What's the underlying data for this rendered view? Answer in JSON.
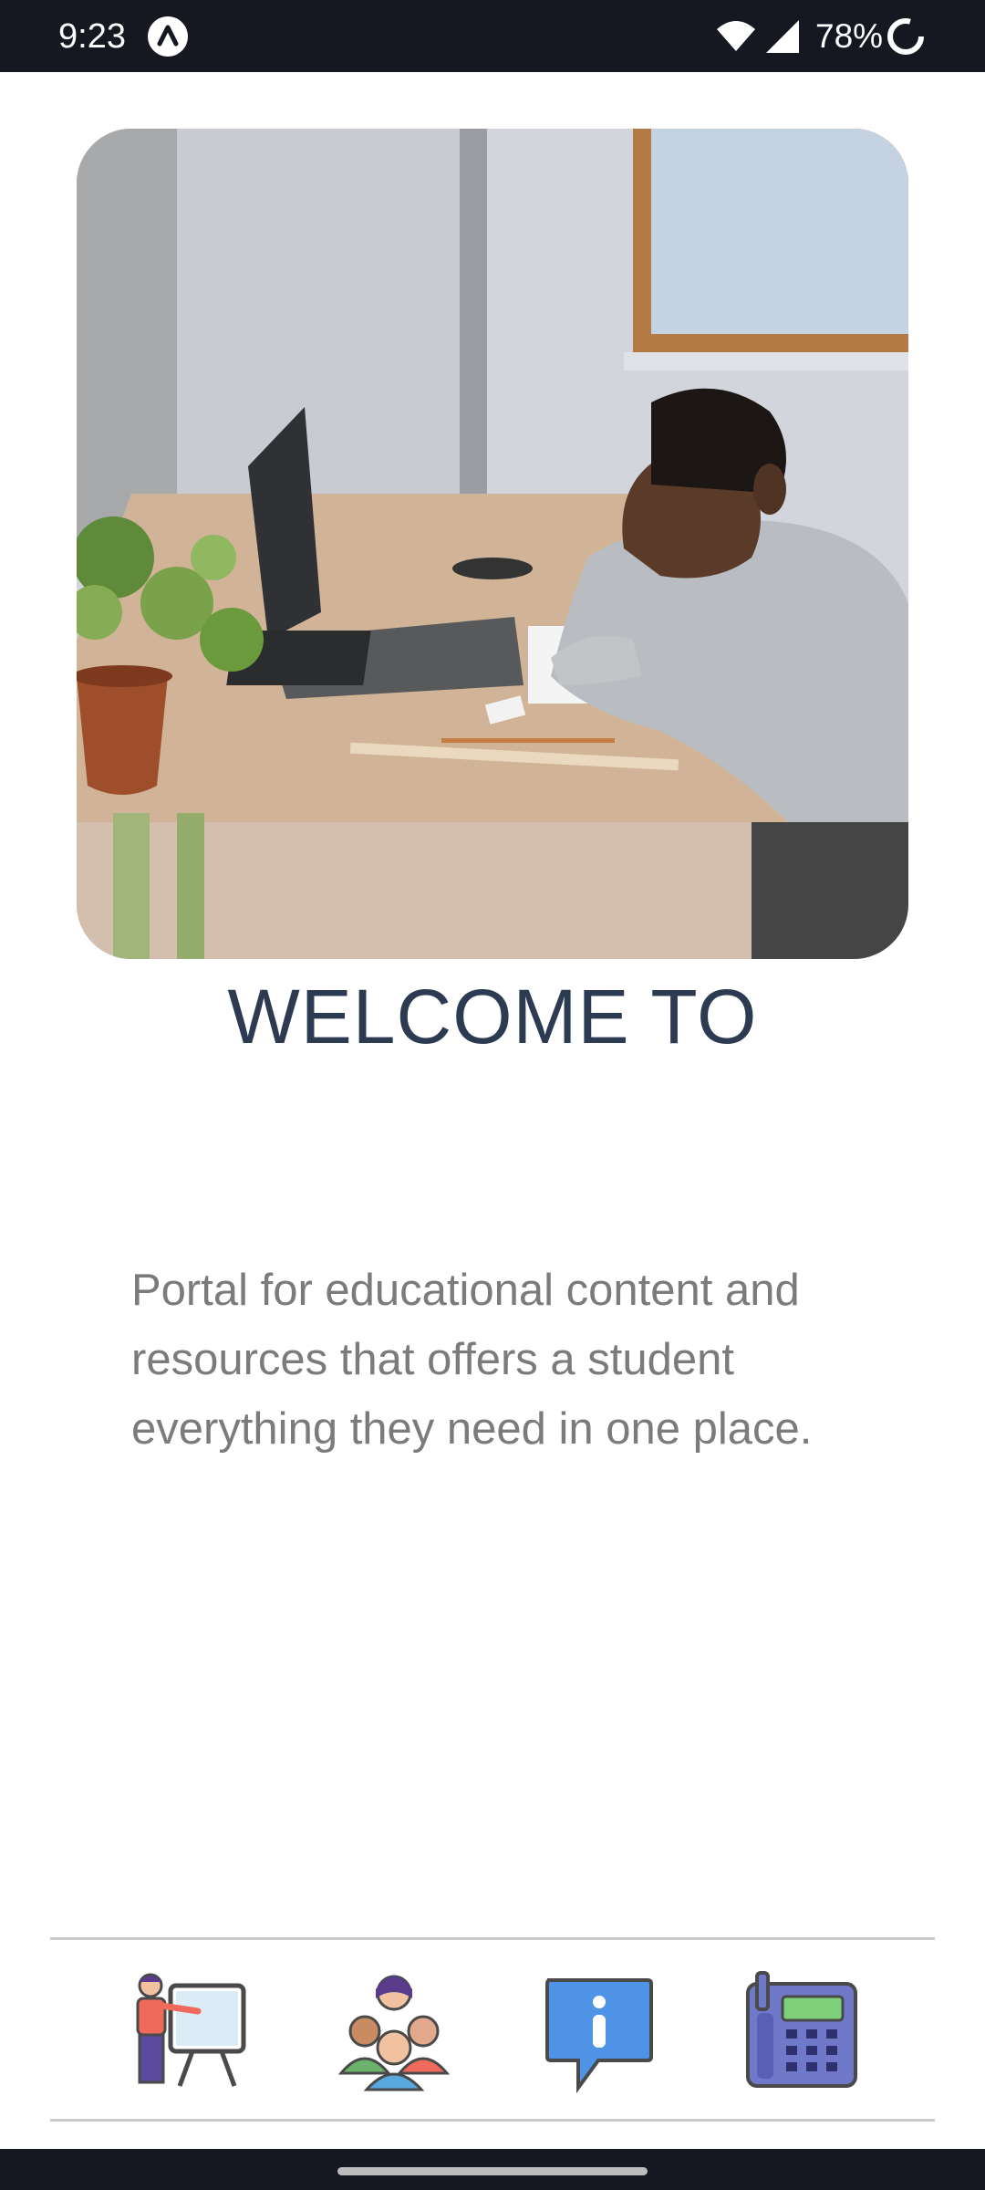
{
  "status_bar": {
    "time": "9:23",
    "battery": "78%",
    "icons": [
      "app-notification-icon",
      "wifi-icon",
      "signal-icon",
      "battery-saver-icon"
    ]
  },
  "hero": {
    "image": "boy-at-laptop-photo"
  },
  "welcome": {
    "title": "WELCOME TO"
  },
  "description": {
    "text": "Portal for educational content and resources that offers a student everything they need in one place."
  },
  "bottom_nav": {
    "items": [
      {
        "icon": "teacher-presentation-icon"
      },
      {
        "icon": "group-people-icon"
      },
      {
        "icon": "info-chat-icon"
      },
      {
        "icon": "telephone-icon"
      }
    ]
  },
  "colors": {
    "status_bar": "#151821",
    "title": "#2c3a52",
    "body_text": "#7b7b7b"
  }
}
